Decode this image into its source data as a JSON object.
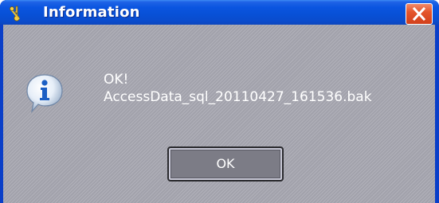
{
  "window": {
    "title": "Information",
    "title_icon": "keys-icon",
    "close_icon": "close-icon"
  },
  "dialog": {
    "icon": "info-icon",
    "message_line1": "OK!",
    "message_line2": "AccessData_sql_20110427_161536.bak",
    "ok_label": "OK"
  },
  "colors": {
    "titlebar": "#0a55e0",
    "close_button": "#e4552b",
    "client_background": "#a8a8b2",
    "text": "#ffffff"
  }
}
